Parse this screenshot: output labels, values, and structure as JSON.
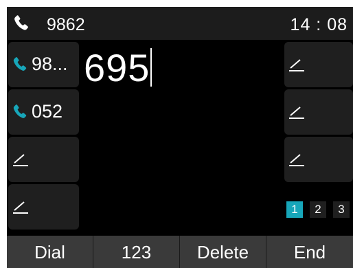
{
  "status": {
    "account": "9862",
    "time": "14 : 08",
    "phone_icon": "handset-icon"
  },
  "left_keys": [
    {
      "label": "98...",
      "icon": "handset-icon"
    },
    {
      "label": "052",
      "icon": "handset-icon"
    },
    {
      "label": "",
      "icon": "edit-icon"
    },
    {
      "label": "",
      "icon": "edit-icon"
    }
  ],
  "right_keys": [
    {
      "icon": "edit-icon"
    },
    {
      "icon": "edit-icon"
    },
    {
      "icon": "edit-icon"
    }
  ],
  "dial": {
    "number": "695"
  },
  "pages": {
    "items": [
      "1",
      "2",
      "3"
    ],
    "current": "1"
  },
  "softkeys": [
    "Dial",
    "123",
    "Delete",
    "End"
  ],
  "colors": {
    "accent": "#17a6b9",
    "background": "#000000",
    "key": "#1f1f1f",
    "softkey_bar": "#3a3a3a"
  }
}
